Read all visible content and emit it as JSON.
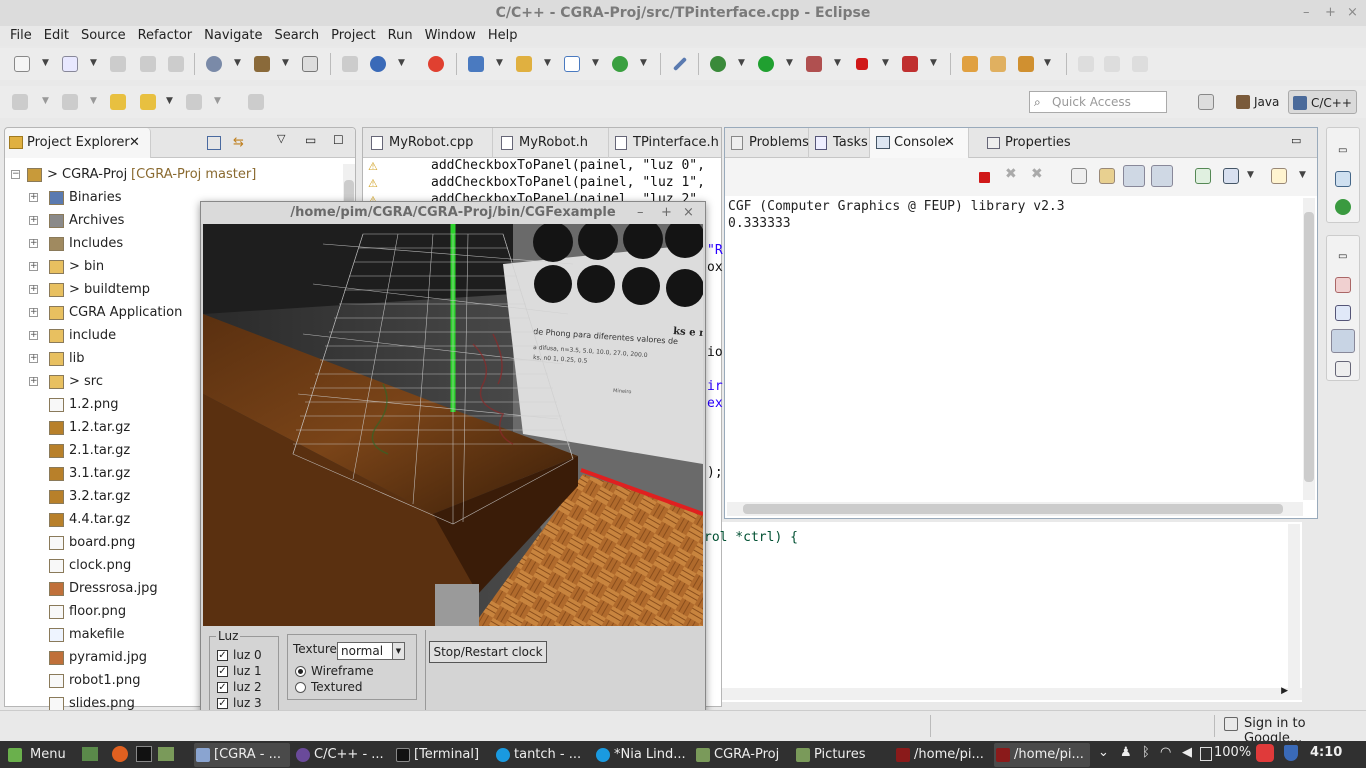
{
  "window": {
    "title": "C/C++ - CGRA-Proj/src/TPinterface.cpp - Eclipse"
  },
  "menu": [
    "File",
    "Edit",
    "Source",
    "Refactor",
    "Navigate",
    "Search",
    "Project",
    "Run",
    "Window",
    "Help"
  ],
  "quick_access": {
    "placeholder": "Quick Access"
  },
  "perspectives": [
    {
      "label": "Java"
    },
    {
      "label": "C/C++"
    }
  ],
  "project_explorer": {
    "tab_label": "Project Explorer",
    "tree": [
      {
        "label": "> CGRA-Proj",
        "decor": "[CGRA-Proj master]",
        "level": 0,
        "expand": "−",
        "icon": "project-icon"
      },
      {
        "label": "Binaries",
        "level": 1,
        "expand": "+",
        "icon": "binaries-icon"
      },
      {
        "label": "Archives",
        "level": 1,
        "expand": "+",
        "icon": "archives-icon"
      },
      {
        "label": "Includes",
        "level": 1,
        "expand": "+",
        "icon": "includes-icon"
      },
      {
        "label": "> bin",
        "level": 1,
        "expand": "+",
        "icon": "folder-icon"
      },
      {
        "label": "> buildtemp",
        "level": 1,
        "expand": "+",
        "icon": "folder-icon"
      },
      {
        "label": "CGRA Application",
        "level": 1,
        "expand": "+",
        "icon": "folder-icon"
      },
      {
        "label": "include",
        "level": 1,
        "expand": "+",
        "icon": "folder-icon"
      },
      {
        "label": "lib",
        "level": 1,
        "expand": "+",
        "icon": "folder-icon"
      },
      {
        "label": "> src",
        "level": 1,
        "expand": "+",
        "icon": "folder-icon"
      },
      {
        "label": "1.2.png",
        "level": 1,
        "expand": "",
        "icon": "file-icon"
      },
      {
        "label": "1.2.tar.gz",
        "level": 1,
        "expand": "",
        "icon": "archive-file-icon"
      },
      {
        "label": "2.1.tar.gz",
        "level": 1,
        "expand": "",
        "icon": "archive-file-icon"
      },
      {
        "label": "3.1.tar.gz",
        "level": 1,
        "expand": "",
        "icon": "archive-file-icon"
      },
      {
        "label": "3.2.tar.gz",
        "level": 1,
        "expand": "",
        "icon": "archive-file-icon"
      },
      {
        "label": "4.4.tar.gz",
        "level": 1,
        "expand": "",
        "icon": "archive-file-icon"
      },
      {
        "label": "board.png",
        "level": 1,
        "expand": "",
        "icon": "file-icon"
      },
      {
        "label": "clock.png",
        "level": 1,
        "expand": "",
        "icon": "file-icon"
      },
      {
        "label": "Dressrosa.jpg",
        "level": 1,
        "expand": "",
        "icon": "image-file-icon"
      },
      {
        "label": "floor.png",
        "level": 1,
        "expand": "",
        "icon": "file-icon"
      },
      {
        "label": "makefile",
        "level": 1,
        "expand": "",
        "icon": "makefile-icon"
      },
      {
        "label": "pyramid.jpg",
        "level": 1,
        "expand": "",
        "icon": "image-file-icon"
      },
      {
        "label": "robot1.png",
        "level": 1,
        "expand": "",
        "icon": "file-icon"
      },
      {
        "label": "slides.png",
        "level": 1,
        "expand": "",
        "icon": "file-icon"
      }
    ]
  },
  "editor": {
    "tabs": [
      "MyRobot.cpp",
      "MyRobot.h",
      "TPinterface.h"
    ],
    "lines": [
      "addCheckboxToPanel(painel, \"luz 0\",",
      "addCheckboxToPanel(painel, \"luz 1\",",
      "addCheckboxToPanel(painel, \"luz 2\","
    ],
    "fragments": [
      "\"R",
      "ox",
      "io",
      "ir",
      "ex",
      ");",
      "rol *ctrl) {"
    ]
  },
  "console": {
    "tabs": [
      "Problems",
      "Tasks",
      "Console",
      "Properties"
    ],
    "output": [
      "CGF (Computer Graphics @ FEUP) library v2.3",
      "0.333333"
    ]
  },
  "cgf_window": {
    "title": "/home/pim/CGRA/CGRA-Proj/bin/CGFexample",
    "scene_poster": {
      "heading": "de Phong para diferentes valores de",
      "math": "ks e n. Is",
      "lines": [
        "a difusa, n=3.5, 5.0, 10.0, 27.0, 200.0",
        "ks, n0 1, 0.25, 0.5"
      ],
      "footer": "Mineiro"
    },
    "luz_panel": {
      "label": "Luz",
      "items": [
        {
          "label": "luz 0",
          "checked": true
        },
        {
          "label": "luz 1",
          "checked": true
        },
        {
          "label": "luz 2",
          "checked": true
        },
        {
          "label": "luz 3",
          "checked": true
        }
      ]
    },
    "texture": {
      "label": "Texture",
      "value": "normal",
      "options": [
        "Wireframe",
        "Textured"
      ],
      "selected": "Wireframe"
    },
    "clock_button": "Stop/Restart clock"
  },
  "status": {
    "sign_in": "Sign in to Google..."
  },
  "taskbar": {
    "menu_label": "Menu",
    "tasks": [
      "[CGRA - ...",
      "C/C++ - ...",
      "[Terminal]",
      "tantch - ...",
      "*Nia Lind...",
      "CGRA-Proj",
      "Pictures",
      "/home/pi...",
      "/home/pi..."
    ],
    "battery": "100%",
    "clock": "4:10"
  },
  "colors": {
    "accent": "#4a90d9",
    "taskbar": "#303030",
    "green_axis": "#2dd22d",
    "red_axis": "#e02020"
  }
}
